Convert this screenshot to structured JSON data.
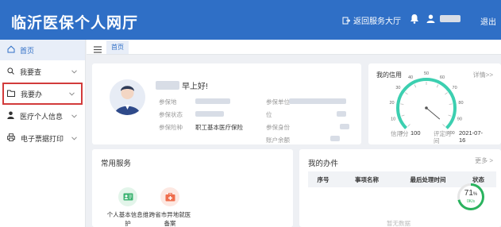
{
  "header": {
    "title": "临沂医保个人网厅",
    "hall_link": "返回服务大厅",
    "logout": "退出"
  },
  "sidebar": {
    "items": [
      {
        "label": "首页",
        "icon": "home-icon"
      },
      {
        "label": "我要查",
        "icon": "search-icon"
      },
      {
        "label": "我要办",
        "icon": "folder-icon"
      },
      {
        "label": "医疗个人信息",
        "icon": "person-icon"
      },
      {
        "label": "电子票据打印",
        "icon": "printer-icon"
      }
    ]
  },
  "tabs": {
    "active": "首页"
  },
  "profile": {
    "greeting": "早上好!",
    "left_labels": [
      "参保地",
      "参保状态",
      "参保险种"
    ],
    "insurance_type": "职工基本医疗保险",
    "right_labels": [
      "参保单位",
      "参保身份",
      "账户余额"
    ],
    "right_label_wrap": "位"
  },
  "credit": {
    "title": "我的信用",
    "more": "详情>>",
    "score_label": "信用分",
    "score": "100",
    "time_label_line1": "评定时",
    "time_label_line2": "间",
    "time_line1": "2021-07-",
    "time_line2": "16",
    "gauge": {
      "min": 0,
      "max": 100,
      "value": 100,
      "ticks": [
        "0",
        "10",
        "20",
        "30",
        "40",
        "50",
        "60",
        "70",
        "80",
        "90",
        "100"
      ]
    }
  },
  "services": {
    "title": "常用服务",
    "items": [
      {
        "line1": "个人基本信息维",
        "line2": "护"
      },
      {
        "line1": "跨省市异地就医",
        "line2": "备案"
      }
    ]
  },
  "todo": {
    "title": "我的办件",
    "more": "更多 >",
    "columns": [
      "序号",
      "事项名称",
      "最后处理时间",
      "状态"
    ],
    "empty_text": "暂无数据"
  },
  "widget": {
    "percent": "71",
    "unit": "%",
    "speed": "0K/s"
  },
  "colors": {
    "primary": "#2f6fc6",
    "highlight": "#d23b3b",
    "gauge": "#3ccfb0"
  }
}
